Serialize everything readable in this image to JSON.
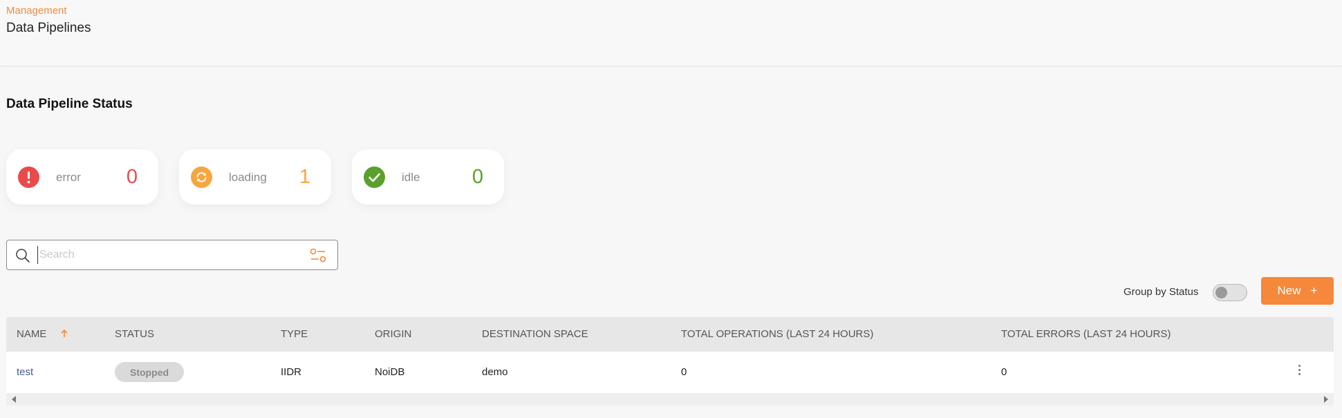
{
  "header": {
    "breadcrumb": "Management",
    "title": "Data Pipelines"
  },
  "section_title": "Data Pipeline Status",
  "status_cards": [
    {
      "label": "error",
      "count": "0",
      "icon": "error-icon",
      "color": "#e94b4b"
    },
    {
      "label": "loading",
      "count": "1",
      "icon": "loading-icon",
      "color": "#f7a63f"
    },
    {
      "label": "idle",
      "count": "0",
      "icon": "check-icon",
      "color": "#5aa02c"
    }
  ],
  "search": {
    "placeholder": "Search",
    "value": ""
  },
  "toolbar": {
    "group_label": "Group by Status",
    "group_enabled": false,
    "new_label": "New",
    "new_icon": "+"
  },
  "table": {
    "columns": [
      "NAME",
      "STATUS",
      "TYPE",
      "ORIGIN",
      "DESTINATION SPACE",
      "TOTAL OPERATIONS (LAST 24 HOURS)",
      "TOTAL ERRORS (LAST 24 HOURS)"
    ],
    "rows": [
      {
        "name": "test",
        "status": "Stopped",
        "type": "IIDR",
        "origin": "NoiDB",
        "destination": "demo",
        "operations": "0",
        "errors": "0"
      }
    ]
  },
  "colors": {
    "accent": "#f5883a",
    "link": "#4a5a9a"
  }
}
